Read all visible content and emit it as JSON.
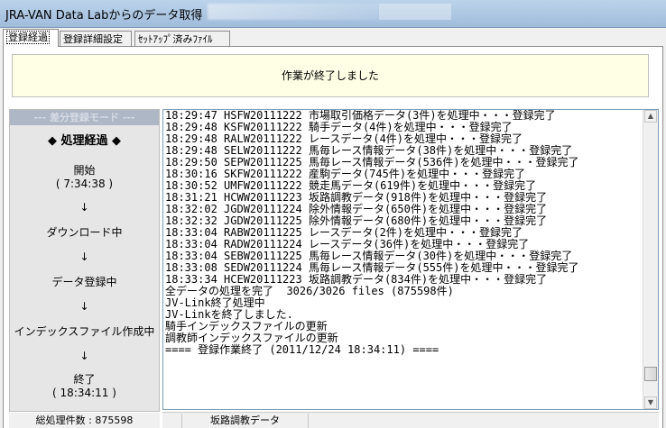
{
  "window": {
    "title": "JRA-VAN Data Labからのデータ取得"
  },
  "tabs": [
    {
      "label": "登録経過"
    },
    {
      "label": "登録詳細設定"
    },
    {
      "label": "ｾｯﾄｱｯﾌﾟ済みﾌｧｲﾙ"
    }
  ],
  "banner": {
    "message": "作業が終了しました"
  },
  "sidebar": {
    "mode": "--- 差分登録モード ---",
    "heading": "◆ 処理経過 ◆",
    "steps": [
      {
        "label": "開始",
        "time": "( 7:34:38 )"
      },
      {
        "label": "ダウンロード中"
      },
      {
        "label": "データ登録中"
      },
      {
        "label": "インデックスファイル作成中"
      },
      {
        "label": "終了",
        "time": "( 18:34:11 )"
      }
    ],
    "arrow": "↓",
    "total": "総処理件数 : 875598"
  },
  "log": {
    "lines": [
      "18:29:47 HSFW20111222 市場取引価格データ(3件)を処理中・・・登録完了",
      "18:29:48 KSFW20111222 騎手データ(4件)を処理中・・・登録完了",
      "18:29:48 RALW20111222 レースデータ(4件)を処理中・・・登録完了",
      "18:29:48 SELW20111222 馬毎レース情報データ(38件)を処理中・・・登録完了",
      "18:29:50 SEPW20111225 馬毎レース情報データ(536件)を処理中・・・登録完了",
      "18:30:16 SKFW20111222 産駒データ(745件)を処理中・・・登録完了",
      "18:30:52 UMFW20111222 競走馬データ(619件)を処理中・・・登録完了",
      "18:31:21 HCWW20111223 坂路調教データ(918件)を処理中・・・登録完了",
      "18:32:02 JGDW20111224 除外情報データ(650件)を処理中・・・登録完了",
      "18:32:32 JGDW20111225 除外情報データ(680件)を処理中・・・登録完了",
      "18:33:04 RABW20111225 レースデータ(2件)を処理中・・・登録完了",
      "18:33:04 RADW20111224 レースデータ(36件)を処理中・・・登録完了",
      "18:33:04 SEBW20111225 馬毎レース情報データ(30件)を処理中・・・登録完了",
      "18:33:08 SEDW20111224 馬毎レース情報データ(555件)を処理中・・・登録完了",
      "18:33:34 HCEW20111223 坂路調教データ(834件)を処理中・・・登録完了",
      "全データの処理を完了  3026/3026 files (875598件)",
      "JV-Link終了処理中",
      "JV-Linkを終了しました.",
      "騎手インデックスファイルの更新",
      "調教師インデックスファイルの更新",
      "==== 登録作業終了 (2011/12/24 18:34:11) ===="
    ]
  },
  "statusbar": {
    "current_item": "坂路調教データ"
  },
  "icons": {
    "scroll_up": "scroll-up-arrow-icon",
    "scroll_down": "scroll-down-arrow-icon"
  }
}
